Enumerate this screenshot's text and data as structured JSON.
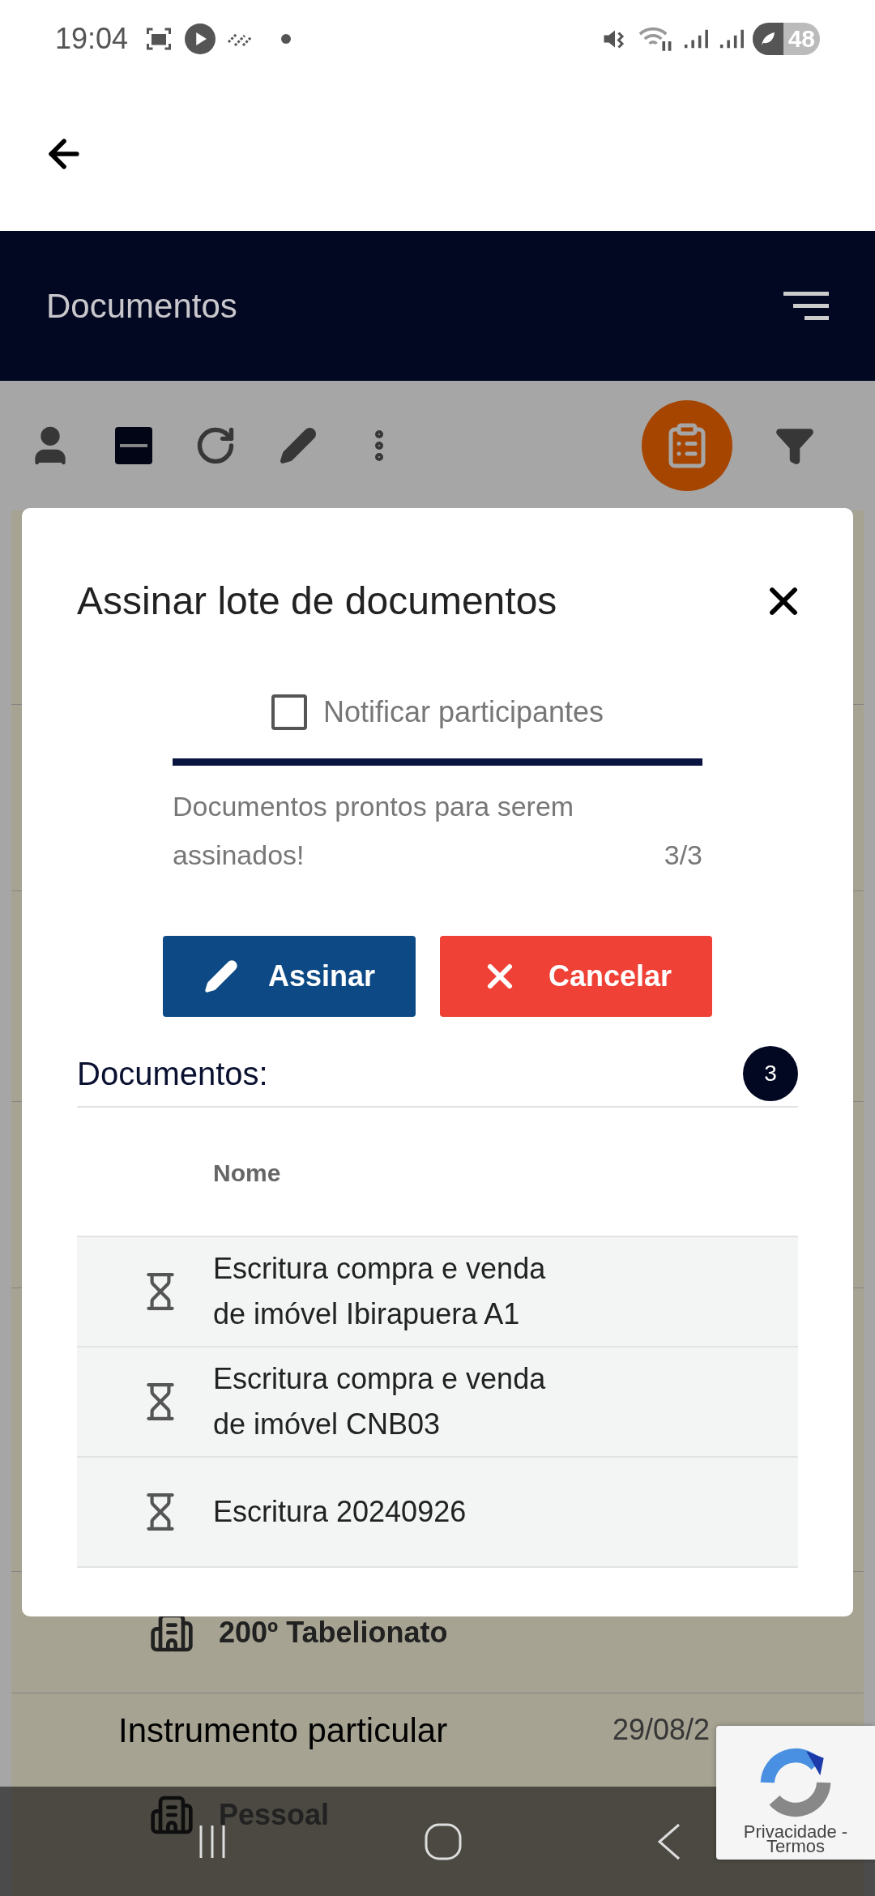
{
  "status_bar": {
    "time": "19:04",
    "battery": "48"
  },
  "header": {
    "title": "Documentos"
  },
  "toolbar": {
    "select_all": {
      "indeterminate": true
    }
  },
  "dialog": {
    "title": "Assinar lote de documentos",
    "notify": {
      "label": "Notificar participantes",
      "checked": false
    },
    "progress": {
      "level": 1,
      "message": "Documentos prontos para serem assinados!",
      "count": "3/3"
    },
    "buttons": [
      {
        "kind": "sign",
        "label": "Assinar"
      },
      {
        "kind": "cancel",
        "label": "Cancelar"
      }
    ],
    "documents": {
      "label": "Documentos:",
      "count": "3",
      "column": "Nome",
      "rows": [
        {
          "name": "Escritura compra e venda de imóvel Ibirapuera A1"
        },
        {
          "name": "Escritura compra e venda de imóvel CNB03"
        },
        {
          "name": "Escritura 20240926"
        }
      ]
    }
  },
  "background_list": [
    {
      "kind": "office",
      "text": "200º Tabelionato"
    },
    {
      "kind": "document",
      "text": "Instrumento particular",
      "date": "29/08/2"
    },
    {
      "kind": "office",
      "text": "Pessoal"
    }
  ],
  "recaptcha": {
    "lines": [
      "Privacidade -",
      "Termos"
    ]
  }
}
